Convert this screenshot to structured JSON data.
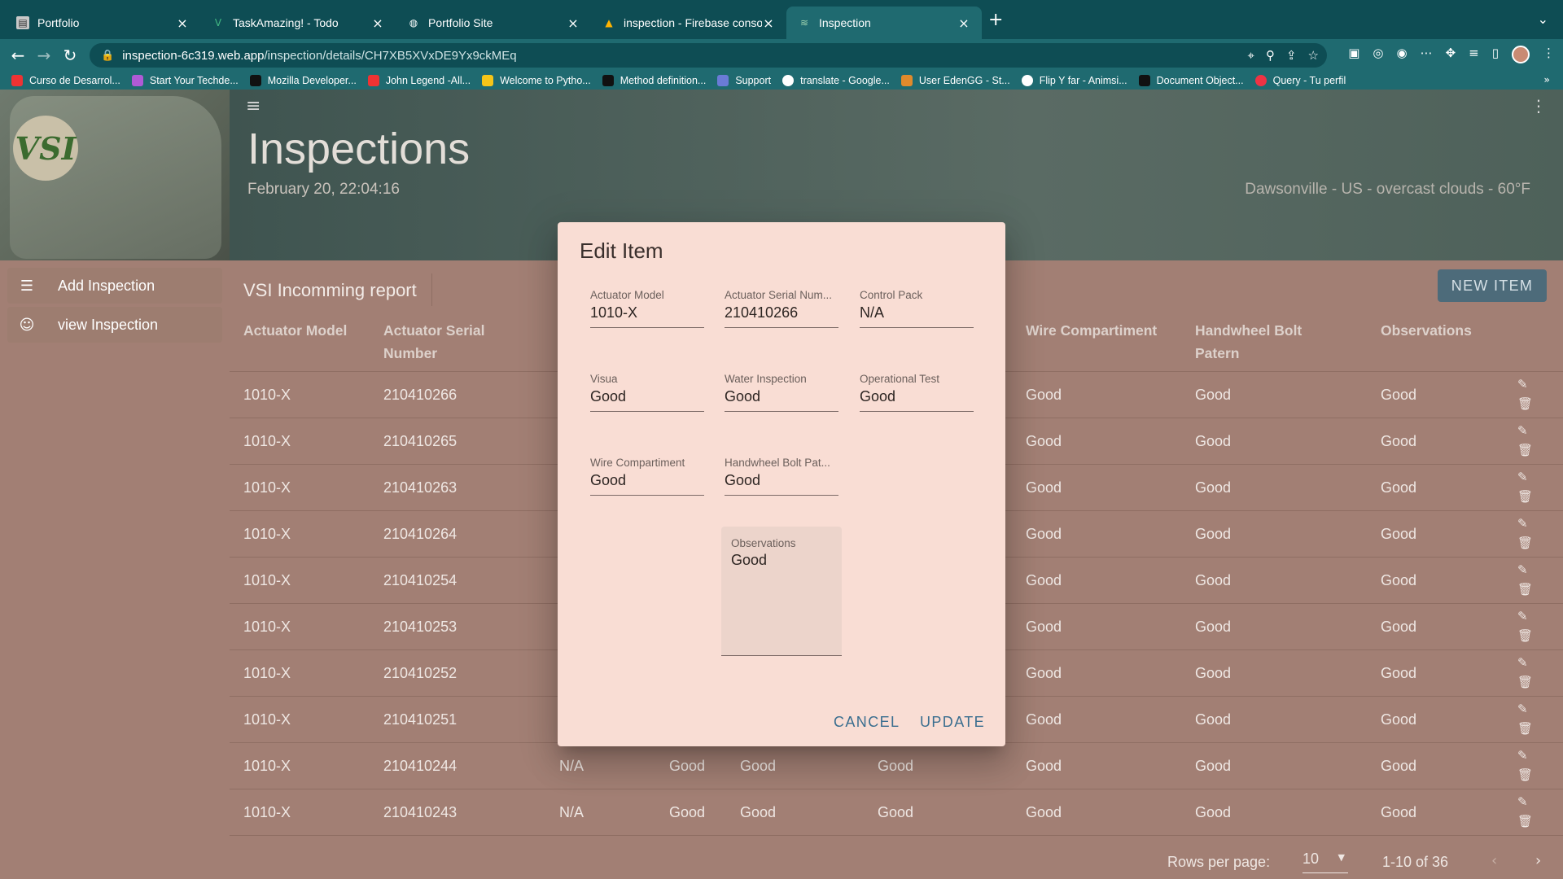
{
  "browser": {
    "tabs": [
      {
        "title": "Portfolio",
        "favicon": "flag-icon"
      },
      {
        "title": "TaskAmazing! - Todo",
        "favicon": "vue-icon"
      },
      {
        "title": "Portfolio Site",
        "favicon": "globe-icon"
      },
      {
        "title": "inspection - Firebase console",
        "favicon": "firebase-icon"
      },
      {
        "title": "Inspection",
        "favicon": "vsi-icon",
        "active": true
      }
    ],
    "url_host": "inspection-6c319.web.app",
    "url_path": "/inspection/details/CH7XB5XVxDE9Yx9ckMEq",
    "bookmarks": [
      "Curso de Desarrol...",
      "Start Your Techde...",
      "Mozilla Developer...",
      "John Legend -All...",
      "Welcome to Pytho...",
      "Method definition...",
      "Support",
      "translate - Google...",
      "User EdenGG - St...",
      "Flip Y far - Animsi...",
      "Document Object...",
      "Query - Tu perfil"
    ]
  },
  "sidebar": {
    "logo_text": "VSI",
    "items": [
      {
        "label": "Add Inspection",
        "icon": "checklist-icon"
      },
      {
        "label": "view Inspection",
        "icon": "sunglasses-icon"
      }
    ]
  },
  "header": {
    "title": "Inspections",
    "datetime": "February 20, 22:04:16",
    "weather": "Dawsonville - US - overcast clouds - 60°F"
  },
  "table": {
    "title": "VSI Incomming report",
    "new_item_label": "NEW ITEM",
    "headers": {
      "actuator_model": "Actuator Model",
      "actuator_serial": "Actuator Serial Number",
      "wire_compartment": "Wire Compartiment",
      "handwheel_bolt": "Handwheel Bolt Patern",
      "observations": "Observations"
    },
    "rows": [
      {
        "model": "1010-X",
        "serial": "210410266",
        "c3": "",
        "c4": "",
        "c5": "",
        "c6": "",
        "wire": "Good",
        "handwheel": "Good",
        "obs": "Good"
      },
      {
        "model": "1010-X",
        "serial": "210410265",
        "c3": "",
        "c4": "",
        "c5": "",
        "c6": "",
        "wire": "Good",
        "handwheel": "Good",
        "obs": "Good"
      },
      {
        "model": "1010-X",
        "serial": "210410263",
        "c3": "",
        "c4": "",
        "c5": "",
        "c6": "",
        "wire": "Good",
        "handwheel": "Good",
        "obs": "Good"
      },
      {
        "model": "1010-X",
        "serial": "210410264",
        "c3": "",
        "c4": "",
        "c5": "",
        "c6": "",
        "wire": "Good",
        "handwheel": "Good",
        "obs": "Good"
      },
      {
        "model": "1010-X",
        "serial": "210410254",
        "c3": "",
        "c4": "",
        "c5": "",
        "c6": "",
        "wire": "Good",
        "handwheel": "Good",
        "obs": "Good"
      },
      {
        "model": "1010-X",
        "serial": "210410253",
        "c3": "",
        "c4": "",
        "c5": "",
        "c6": "",
        "wire": "Good",
        "handwheel": "Good",
        "obs": "Good"
      },
      {
        "model": "1010-X",
        "serial": "210410252",
        "c3": "",
        "c4": "",
        "c5": "",
        "c6": "",
        "wire": "Good",
        "handwheel": "Good",
        "obs": "Good"
      },
      {
        "model": "1010-X",
        "serial": "210410251",
        "c3": "",
        "c4": "",
        "c5": "",
        "c6": "",
        "wire": "Good",
        "handwheel": "Good",
        "obs": "Good"
      },
      {
        "model": "1010-X",
        "serial": "210410244",
        "c3": "N/A",
        "c4": "Good",
        "c5": "Good",
        "c6": "Good",
        "wire": "Good",
        "handwheel": "Good",
        "obs": "Good"
      },
      {
        "model": "1010-X",
        "serial": "210410243",
        "c3": "N/A",
        "c4": "Good",
        "c5": "Good",
        "c6": "Good",
        "wire": "Good",
        "handwheel": "Good",
        "obs": "Good"
      }
    ],
    "footer": {
      "rows_per_page_label": "Rows per page:",
      "rows_per_page_value": "10",
      "range": "1-10 of 36"
    }
  },
  "dialog": {
    "title": "Edit Item",
    "fields": [
      {
        "label": "Actuator Model",
        "value": "1010-X"
      },
      {
        "label": "Actuator Serial Num...",
        "value": "210410266"
      },
      {
        "label": "Control Pack",
        "value": "N/A"
      },
      {
        "label": "Visua",
        "value": "Good"
      },
      {
        "label": "Water Inspection",
        "value": "Good"
      },
      {
        "label": "Operational Test",
        "value": "Good"
      },
      {
        "label": "Wire Compartiment",
        "value": "Good"
      },
      {
        "label": "Handwheel Bolt Pat...",
        "value": "Good"
      }
    ],
    "observations": {
      "label": "Observations",
      "value": "Good"
    },
    "cancel_label": "CANCEL",
    "update_label": "UPDATE"
  },
  "colors": {
    "overlay_page": "#a27f74",
    "dialog_bg": "#f9ddd4",
    "primary": "#3a6e8f",
    "chrome": "#1f6a70"
  }
}
